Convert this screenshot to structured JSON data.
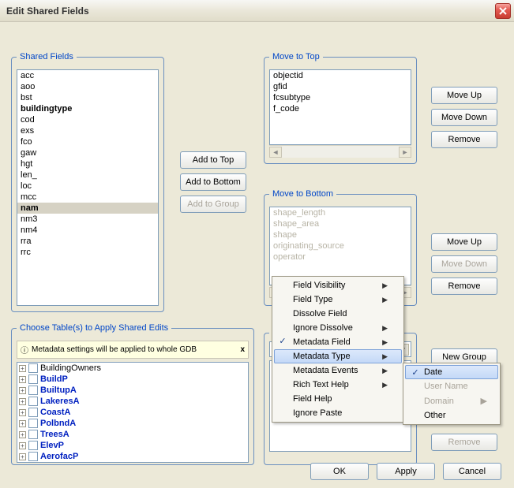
{
  "window": {
    "title": "Edit Shared Fields"
  },
  "shared_fields": {
    "legend": "Shared Fields",
    "items": [
      {
        "t": "acc",
        "bold": false,
        "sel": false
      },
      {
        "t": "aoo",
        "bold": false,
        "sel": false
      },
      {
        "t": "bst",
        "bold": false,
        "sel": false
      },
      {
        "t": "buildingtype",
        "bold": true,
        "sel": false
      },
      {
        "t": "cod",
        "bold": false,
        "sel": false
      },
      {
        "t": "exs",
        "bold": false,
        "sel": false
      },
      {
        "t": "fco",
        "bold": false,
        "sel": false
      },
      {
        "t": "gaw",
        "bold": false,
        "sel": false
      },
      {
        "t": "hgt",
        "bold": false,
        "sel": false
      },
      {
        "t": "len_",
        "bold": false,
        "sel": false
      },
      {
        "t": "loc",
        "bold": false,
        "sel": false
      },
      {
        "t": "mcc",
        "bold": false,
        "sel": false
      },
      {
        "t": "nam",
        "bold": true,
        "sel": true
      },
      {
        "t": "nm3",
        "bold": false,
        "sel": false
      },
      {
        "t": "nm4",
        "bold": false,
        "sel": false
      },
      {
        "t": "rra",
        "bold": false,
        "sel": false
      },
      {
        "t": "rrc",
        "bold": false,
        "sel": false
      }
    ]
  },
  "mid_buttons": {
    "add_top": "Add to Top",
    "add_bottom": "Add to Bottom",
    "add_group": "Add to Group"
  },
  "move_top": {
    "legend": "Move to Top",
    "items": [
      "objectid",
      "gfid",
      "fcsubtype",
      "f_code"
    ]
  },
  "right_top": {
    "up": "Move Up",
    "down": "Move Down",
    "remove": "Remove"
  },
  "move_bottom": {
    "legend": "Move to Bottom",
    "items": [
      "shape_length",
      "shape_area",
      "shape",
      "originating_source",
      "operator"
    ]
  },
  "right_bottom": {
    "up": "Move Up",
    "down": "Move Down",
    "remove": "Remove"
  },
  "tables": {
    "legend": "Choose Table(s) to Apply Shared Edits",
    "info_icon": "ⓘ",
    "info": "Metadata settings will be applied to whole GDB",
    "info_close": "x",
    "rows": [
      {
        "label": "BuildingOwners",
        "plain": true
      },
      {
        "label": "BuildP",
        "plain": false
      },
      {
        "label": "BuiltupA",
        "plain": false
      },
      {
        "label": "LakeresA",
        "plain": false
      },
      {
        "label": "CoastA",
        "plain": false
      },
      {
        "label": "PolbndA",
        "plain": false
      },
      {
        "label": "TreesA",
        "plain": false
      },
      {
        "label": "ElevP",
        "plain": false
      },
      {
        "label": "AerofacP",
        "plain": false
      }
    ]
  },
  "groups": {
    "checkmark": "✓"
  },
  "right_groups": {
    "new": "New Group",
    "remove": "Remove"
  },
  "dialog_buttons": {
    "ok": "OK",
    "apply": "Apply",
    "cancel": "Cancel"
  },
  "context_menu": {
    "items": [
      {
        "label": "Field Visibility",
        "sub": true,
        "hl": false,
        "checked": false
      },
      {
        "label": "Field Type",
        "sub": true,
        "hl": false,
        "checked": false
      },
      {
        "label": "Dissolve Field",
        "sub": false,
        "hl": false,
        "checked": false
      },
      {
        "label": "Ignore Dissolve",
        "sub": true,
        "hl": false,
        "checked": false
      },
      {
        "label": "Metadata Field",
        "sub": true,
        "hl": false,
        "checked": true
      },
      {
        "label": "Metadata Type",
        "sub": true,
        "hl": true,
        "checked": false
      },
      {
        "label": "Metadata Events",
        "sub": true,
        "hl": false,
        "checked": false
      },
      {
        "label": "Rich Text Help",
        "sub": true,
        "hl": false,
        "checked": false
      },
      {
        "label": "Field Help",
        "sub": false,
        "hl": false,
        "checked": false
      },
      {
        "label": "Ignore Paste",
        "sub": false,
        "hl": false,
        "checked": false
      }
    ]
  },
  "submenu": {
    "items": [
      {
        "label": "Date",
        "hl": true,
        "checked": true,
        "dis": false,
        "sub": false
      },
      {
        "label": "User Name",
        "hl": false,
        "checked": false,
        "dis": true,
        "sub": false
      },
      {
        "label": "Domain",
        "hl": false,
        "checked": false,
        "dis": true,
        "sub": true
      },
      {
        "label": "Other",
        "hl": false,
        "checked": false,
        "dis": false,
        "sub": false
      }
    ]
  },
  "glyphs": {
    "left": "◄",
    "right": "►",
    "down": "▼",
    "plus": "+",
    "check": "✓",
    "sub": "▶"
  }
}
